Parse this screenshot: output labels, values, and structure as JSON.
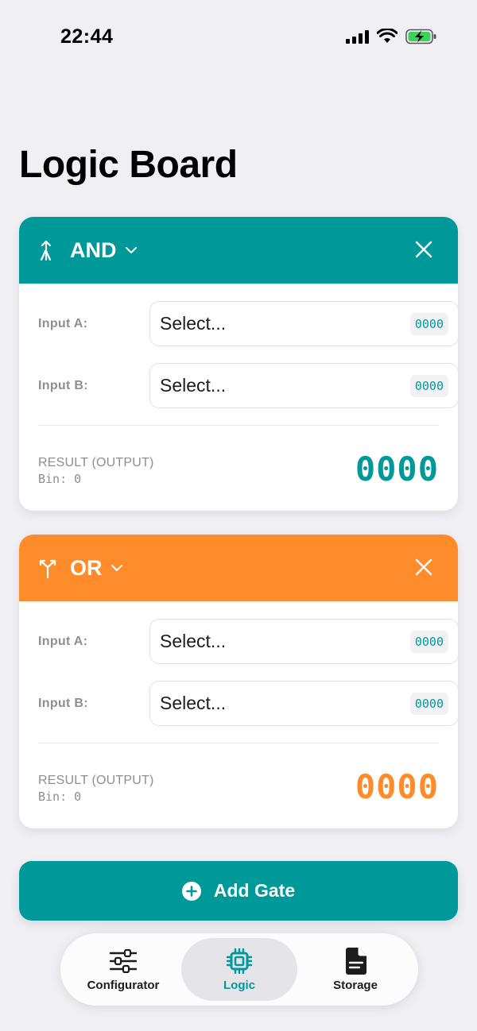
{
  "status_bar": {
    "time": "22:44"
  },
  "page": {
    "title": "Logic Board"
  },
  "colors": {
    "teal": "#00999a",
    "orange": "#ff8c2a"
  },
  "gates": [
    {
      "type": "AND",
      "icon": "merge-arrow-icon",
      "color": "#00999a",
      "inputs": [
        {
          "label": "Input A:",
          "value": "Select...",
          "hex": "0000"
        },
        {
          "label": "Input B:",
          "value": "Select...",
          "hex": "0000"
        }
      ],
      "result_label": "RESULT (OUTPUT)",
      "result_bin": "Bin: 0",
      "result_value": "0000"
    },
    {
      "type": "OR",
      "icon": "split-arrow-icon",
      "color": "#ff8c2a",
      "inputs": [
        {
          "label": "Input A:",
          "value": "Select...",
          "hex": "0000"
        },
        {
          "label": "Input B:",
          "value": "Select...",
          "hex": "0000"
        }
      ],
      "result_label": "RESULT (OUTPUT)",
      "result_bin": "Bin: 0",
      "result_value": "0000"
    }
  ],
  "add_gate": {
    "label": "Add Gate",
    "icon": "plus-circle-icon"
  },
  "tab_bar": {
    "items": [
      {
        "label": "Configurator",
        "icon": "sliders-icon",
        "active": false
      },
      {
        "label": "Logic",
        "icon": "chip-icon",
        "active": true
      },
      {
        "label": "Storage",
        "icon": "document-icon",
        "active": false
      }
    ]
  }
}
